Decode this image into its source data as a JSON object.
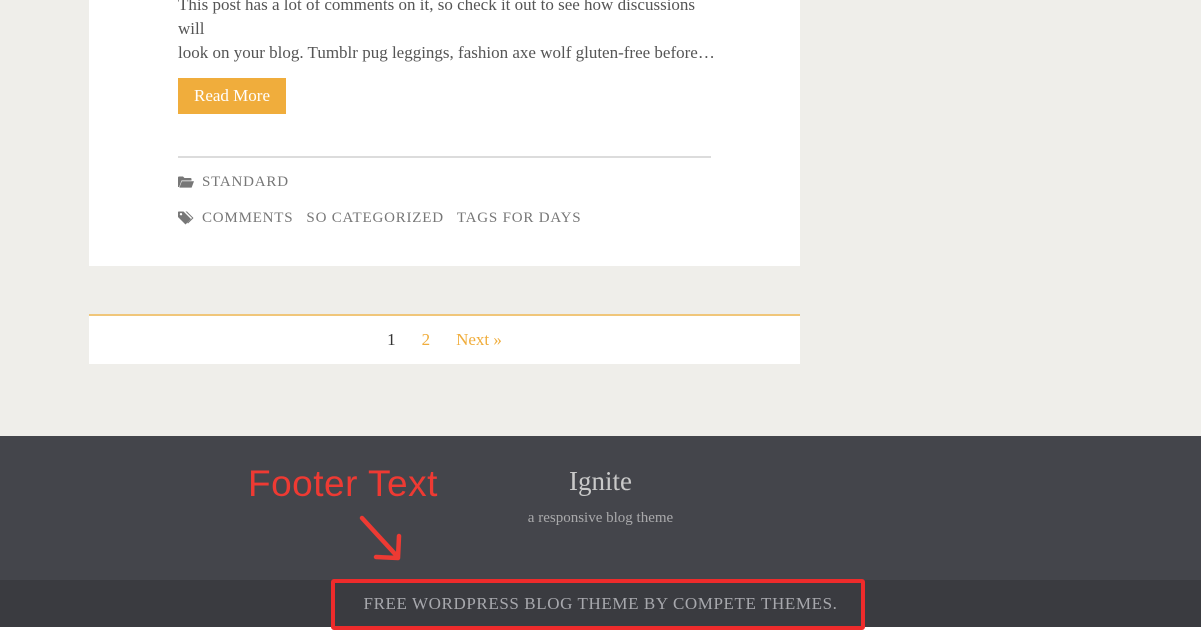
{
  "post": {
    "excerpt_line_1": "This post has a lot of comments on it, so check it out to see how discussions will",
    "excerpt_line_2": "look on your blog. Tumblr pug leggings, fashion axe wolf gluten-free before…",
    "read_more_label": "Read More",
    "categories": [
      {
        "label": "Standard"
      }
    ],
    "tags": [
      {
        "label": "Comments"
      },
      {
        "label": "So Categorized"
      },
      {
        "label": "Tags For Days"
      }
    ],
    "category_icon": "folder-icon",
    "tag_icon": "tag-icon"
  },
  "pagination": {
    "current": "1",
    "page_2": "2",
    "next_label": "Next »"
  },
  "footer": {
    "site_title": "Ignite",
    "tagline": "a responsive blog theme",
    "design_credit": "Free WordPress Blog Theme by Compete Themes."
  },
  "annotation": {
    "label": "Footer Text",
    "color": "#ee3a33"
  },
  "colors": {
    "accent": "#f0ad3c",
    "footer_bg": "#44454b",
    "footer_bottom_bg": "#3a3b40",
    "page_bg": "#efeeea"
  }
}
